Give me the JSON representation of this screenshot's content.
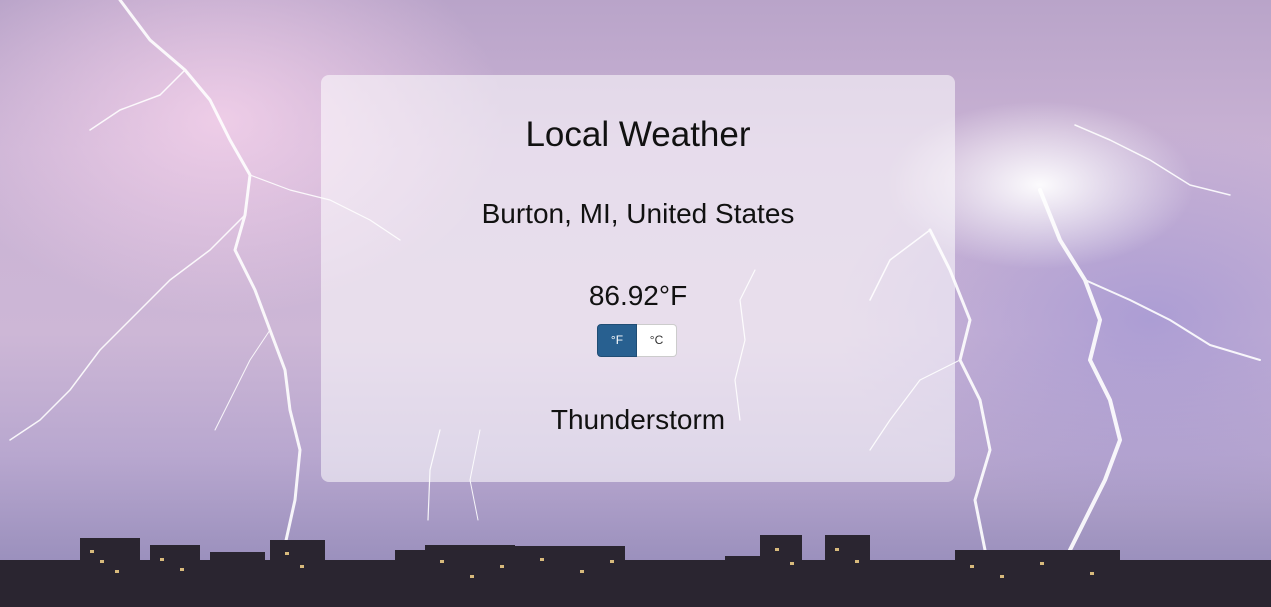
{
  "app": {
    "title": "Local Weather"
  },
  "weather": {
    "location": "Burton, MI, United States",
    "temperature": "86.92°F",
    "condition": "Thunderstorm"
  },
  "units_toggle": {
    "fahrenheit_label": "°F",
    "celsius_label": "°C",
    "selected": "°F"
  },
  "background": {
    "icon": "thunderstorm-city-photo",
    "accent_color": "#286090"
  }
}
